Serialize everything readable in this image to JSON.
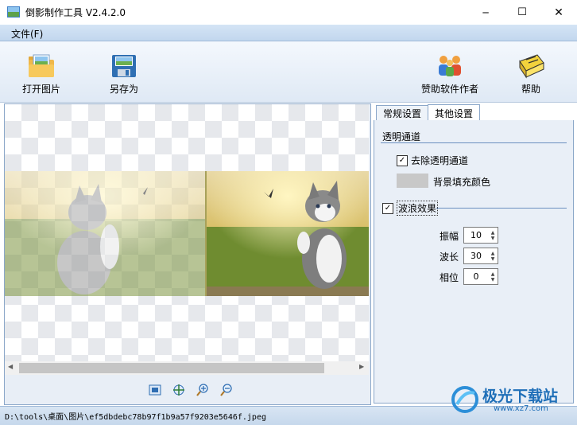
{
  "window": {
    "title": "倒影制作工具 V2.4.2.0",
    "minimize_glyph": "─",
    "maximize_glyph": "☐",
    "close_glyph": "✕"
  },
  "menu": {
    "file": "文件(F)"
  },
  "toolbar": {
    "open": {
      "label": "打开图片",
      "icon": "open-folder-icon"
    },
    "save_as": {
      "label": "另存为",
      "icon": "save-disk-icon"
    },
    "sponsor": {
      "label": "赞助软件作者",
      "icon": "sponsor-people-icon"
    },
    "help": {
      "label": "帮助",
      "icon": "help-book-icon"
    }
  },
  "canvas": {
    "scroll_left_glyph": "◀",
    "scroll_right_glyph": "▶",
    "zoom_tools": [
      "fit-screen-icon",
      "actual-size-icon",
      "zoom-in-icon",
      "zoom-out-icon"
    ]
  },
  "tabs": {
    "general": "常规设置",
    "other": "其他设置",
    "active": "other"
  },
  "transparency": {
    "group_title": "透明通道",
    "remove_alpha_label": "去除透明通道",
    "remove_alpha_checked": true,
    "bg_fill_label": "背景填充颜色",
    "bg_fill_color": "#c8c8c8"
  },
  "wave": {
    "group_title": "波浪效果",
    "enabled": true,
    "amplitude_label": "振幅",
    "amplitude_value": "10",
    "wavelength_label": "波长",
    "wavelength_value": "30",
    "phase_label": "相位",
    "phase_value": "0"
  },
  "status": {
    "path": "D:\\tools\\桌面\\图片\\ef5dbdebc78b97f1b9a57f9203e5646f.jpeg"
  },
  "watermark": {
    "text": "极光下载站",
    "url": "www.xz7.com"
  }
}
